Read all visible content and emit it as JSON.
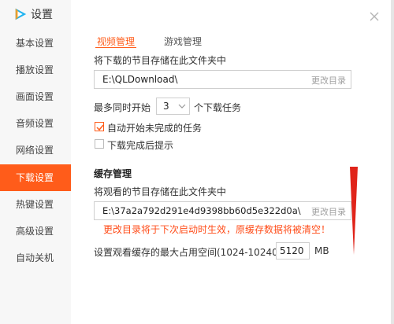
{
  "app": {
    "title": "设置",
    "logo_icon": "tencent-video-logo-icon",
    "accent_color": "#ff5c1a"
  },
  "sidebar": {
    "items": [
      {
        "label": "基本设置",
        "active": false
      },
      {
        "label": "播放设置",
        "active": false
      },
      {
        "label": "画面设置",
        "active": false
      },
      {
        "label": "音频设置",
        "active": false
      },
      {
        "label": "网络设置",
        "active": false
      },
      {
        "label": "下载设置",
        "active": true
      },
      {
        "label": "热键设置",
        "active": false
      },
      {
        "label": "高级设置",
        "active": false
      },
      {
        "label": "自动关机",
        "active": false
      }
    ]
  },
  "tabs": [
    {
      "label": "视频管理",
      "active": true
    },
    {
      "label": "游戏管理",
      "active": false
    }
  ],
  "video": {
    "dir_label": "将下载的节目存储在此文件夹中",
    "dir_value": "E:\\QLDownload\\",
    "change_dir_label": "更改目录",
    "concurrent_prefix": "最多同时开始",
    "concurrent_value": "3",
    "concurrent_suffix": "个下载任务",
    "auto_start_label": "自动开始未完成的任务",
    "auto_start_checked": true,
    "notify_label": "下载完成后提示",
    "notify_checked": false
  },
  "cache": {
    "heading": "缓存管理",
    "dir_label": "将观看的节目存储在此文件夹中",
    "dir_value": "E:\\37a2a792d291e4d9398bb60d5e322d0a\\",
    "change_dir_label": "更改目录",
    "warning": "更改目录将于下次启动时生效，原缓存数据将被清空！",
    "max_size_label": "设置观看缓存的最大占用空间(1024-10240)",
    "max_size_value": "5120",
    "max_size_unit": "MB"
  },
  "icons": {
    "close": "close-icon",
    "dropdown": "chevron-down-icon",
    "check": "check-icon"
  }
}
